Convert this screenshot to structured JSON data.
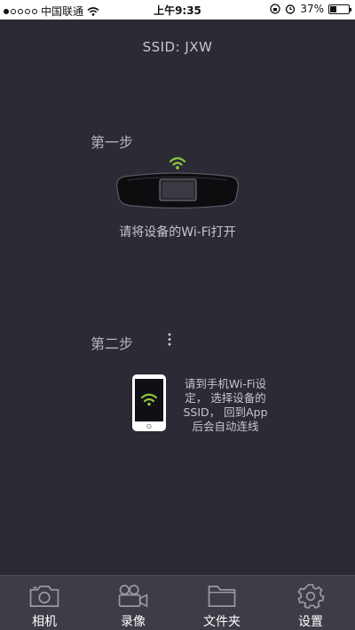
{
  "status_bar": {
    "carrier": "中国联通",
    "time": "上午9:35",
    "battery": "37%",
    "battery_level": 0.37
  },
  "ssid_text": "SSID: JXW",
  "step1": {
    "label": "第一步",
    "caption": "请将设备的Wi-Fi打开"
  },
  "step2": {
    "label": "第二步",
    "caption_lines": [
      "请到手机Wi-Fi设",
      "定， 选择设备的",
      "SSID， 回到App",
      "后会自动连线"
    ]
  },
  "tabs": [
    {
      "label": "相机",
      "icon": "camera-icon"
    },
    {
      "label": "录像",
      "icon": "video-camera-icon"
    },
    {
      "label": "文件夹",
      "icon": "folder-icon"
    },
    {
      "label": "设置",
      "icon": "gear-icon"
    }
  ],
  "colors": {
    "background": "#2b2a35",
    "tabbar": "#3d3c47",
    "wifi_green": "#8dc63f"
  }
}
